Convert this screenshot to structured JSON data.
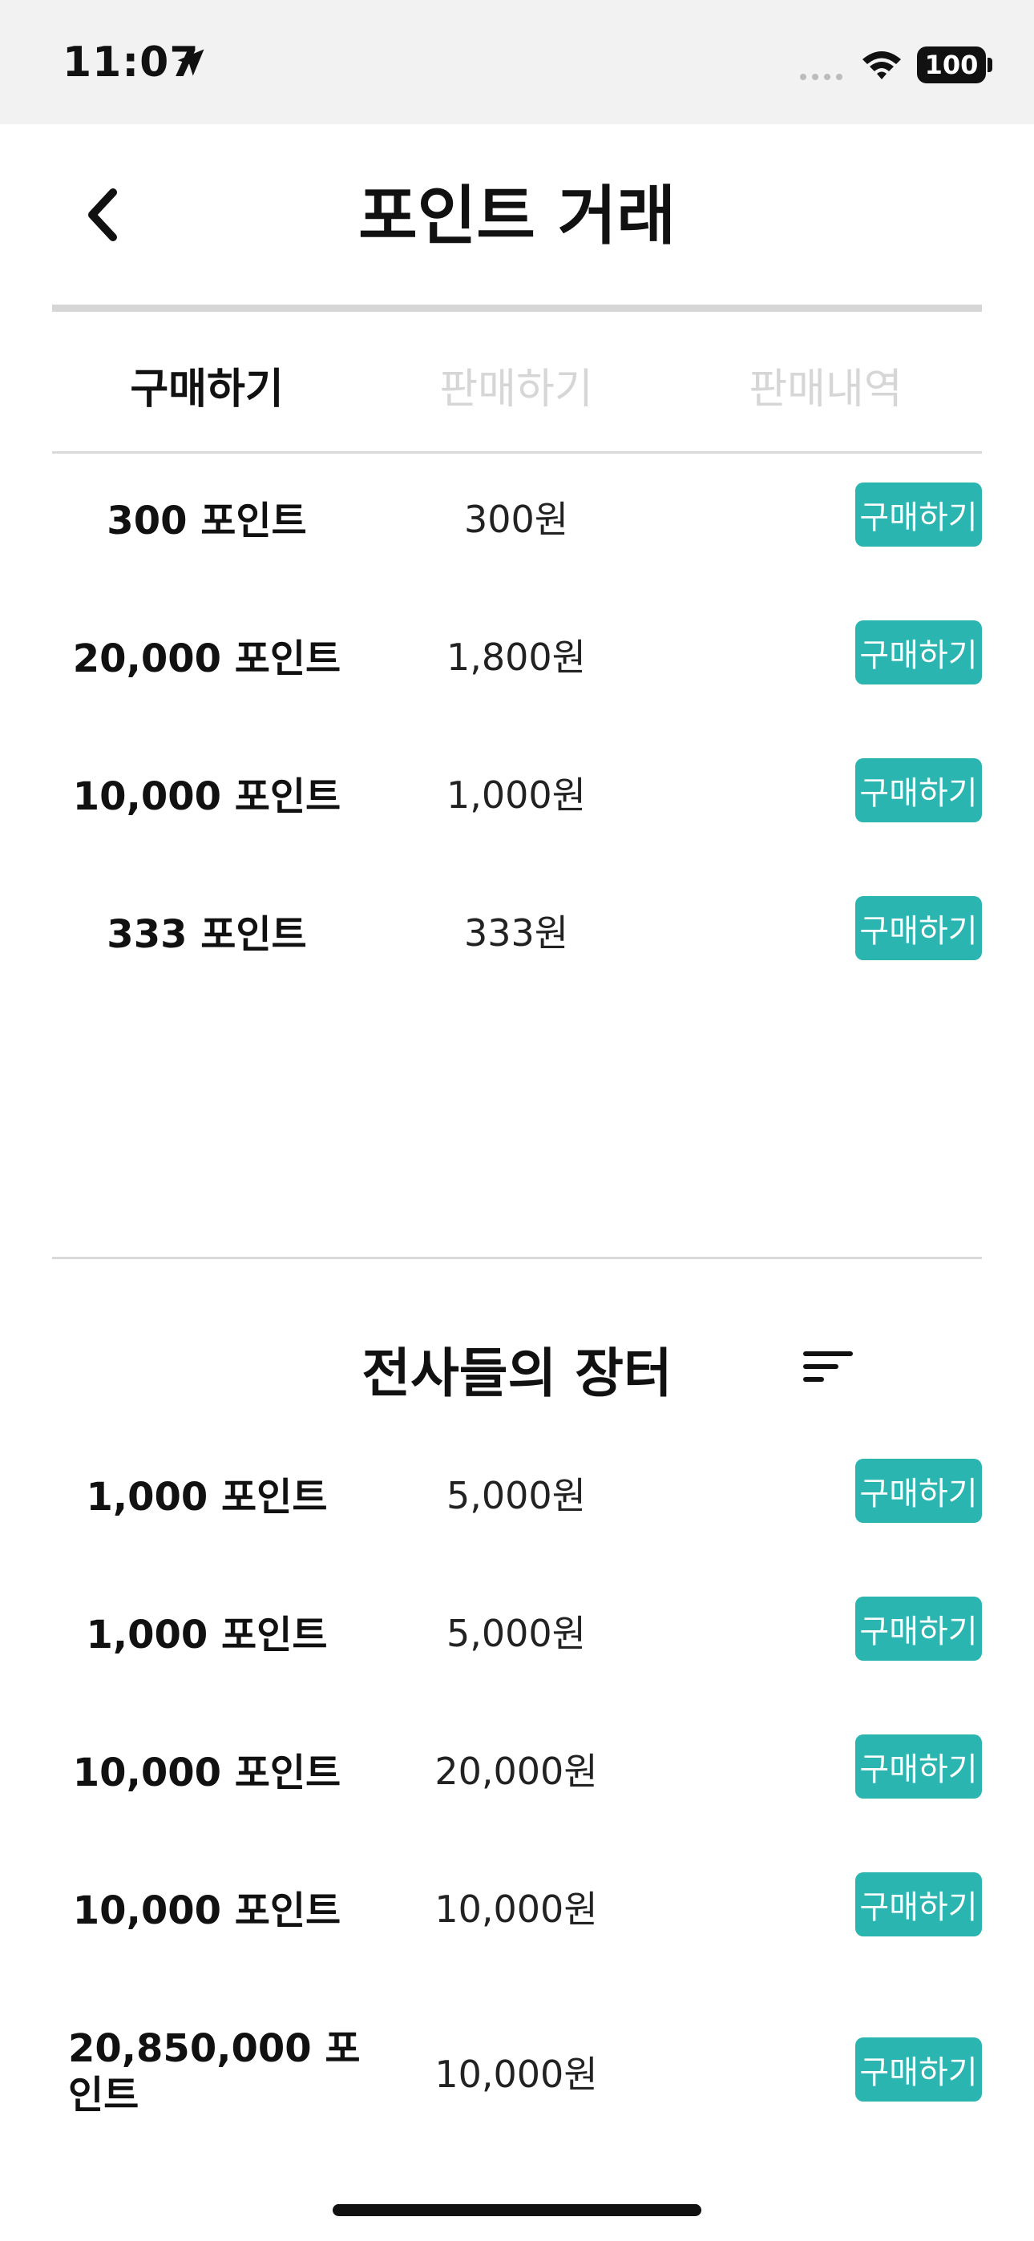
{
  "status_bar": {
    "time": "11:07",
    "battery": "100",
    "icons": [
      "location-arrow-icon",
      "cell-signal-icon",
      "wifi-icon",
      "battery-icon"
    ]
  },
  "header": {
    "title": "포인트 거래",
    "back_icon": "chevron-left-icon"
  },
  "tabs": [
    {
      "label": "구매하기",
      "active": true
    },
    {
      "label": "판매하기",
      "active": false
    },
    {
      "label": "판매내역",
      "active": false
    }
  ],
  "official_offers": [
    {
      "points": "300 포인트",
      "price": "300원",
      "button": "구매하기"
    },
    {
      "points": "20,000 포인트",
      "price": "1,800원",
      "button": "구매하기"
    },
    {
      "points": "10,000 포인트",
      "price": "1,000원",
      "button": "구매하기"
    },
    {
      "points": "333 포인트",
      "price": "333원",
      "button": "구매하기"
    }
  ],
  "market": {
    "title": "전사들의 장터",
    "sort_icon": "sort-lines-icon",
    "offers": [
      {
        "points": "1,000 포인트",
        "price": "5,000원",
        "button": "구매하기"
      },
      {
        "points": "1,000 포인트",
        "price": "5,000원",
        "button": "구매하기"
      },
      {
        "points": "10,000 포인트",
        "price": "20,000원",
        "button": "구매하기"
      },
      {
        "points": "10,000 포인트",
        "price": "10,000원",
        "button": "구매하기"
      },
      {
        "points": "20,850,000 포인트",
        "price": "10,000원",
        "button": "구매하기"
      }
    ]
  },
  "colors": {
    "accent": "#2ab5b0",
    "inactive_tab": "#d6d6d6",
    "status_bar_bg": "#f2f2f2"
  }
}
